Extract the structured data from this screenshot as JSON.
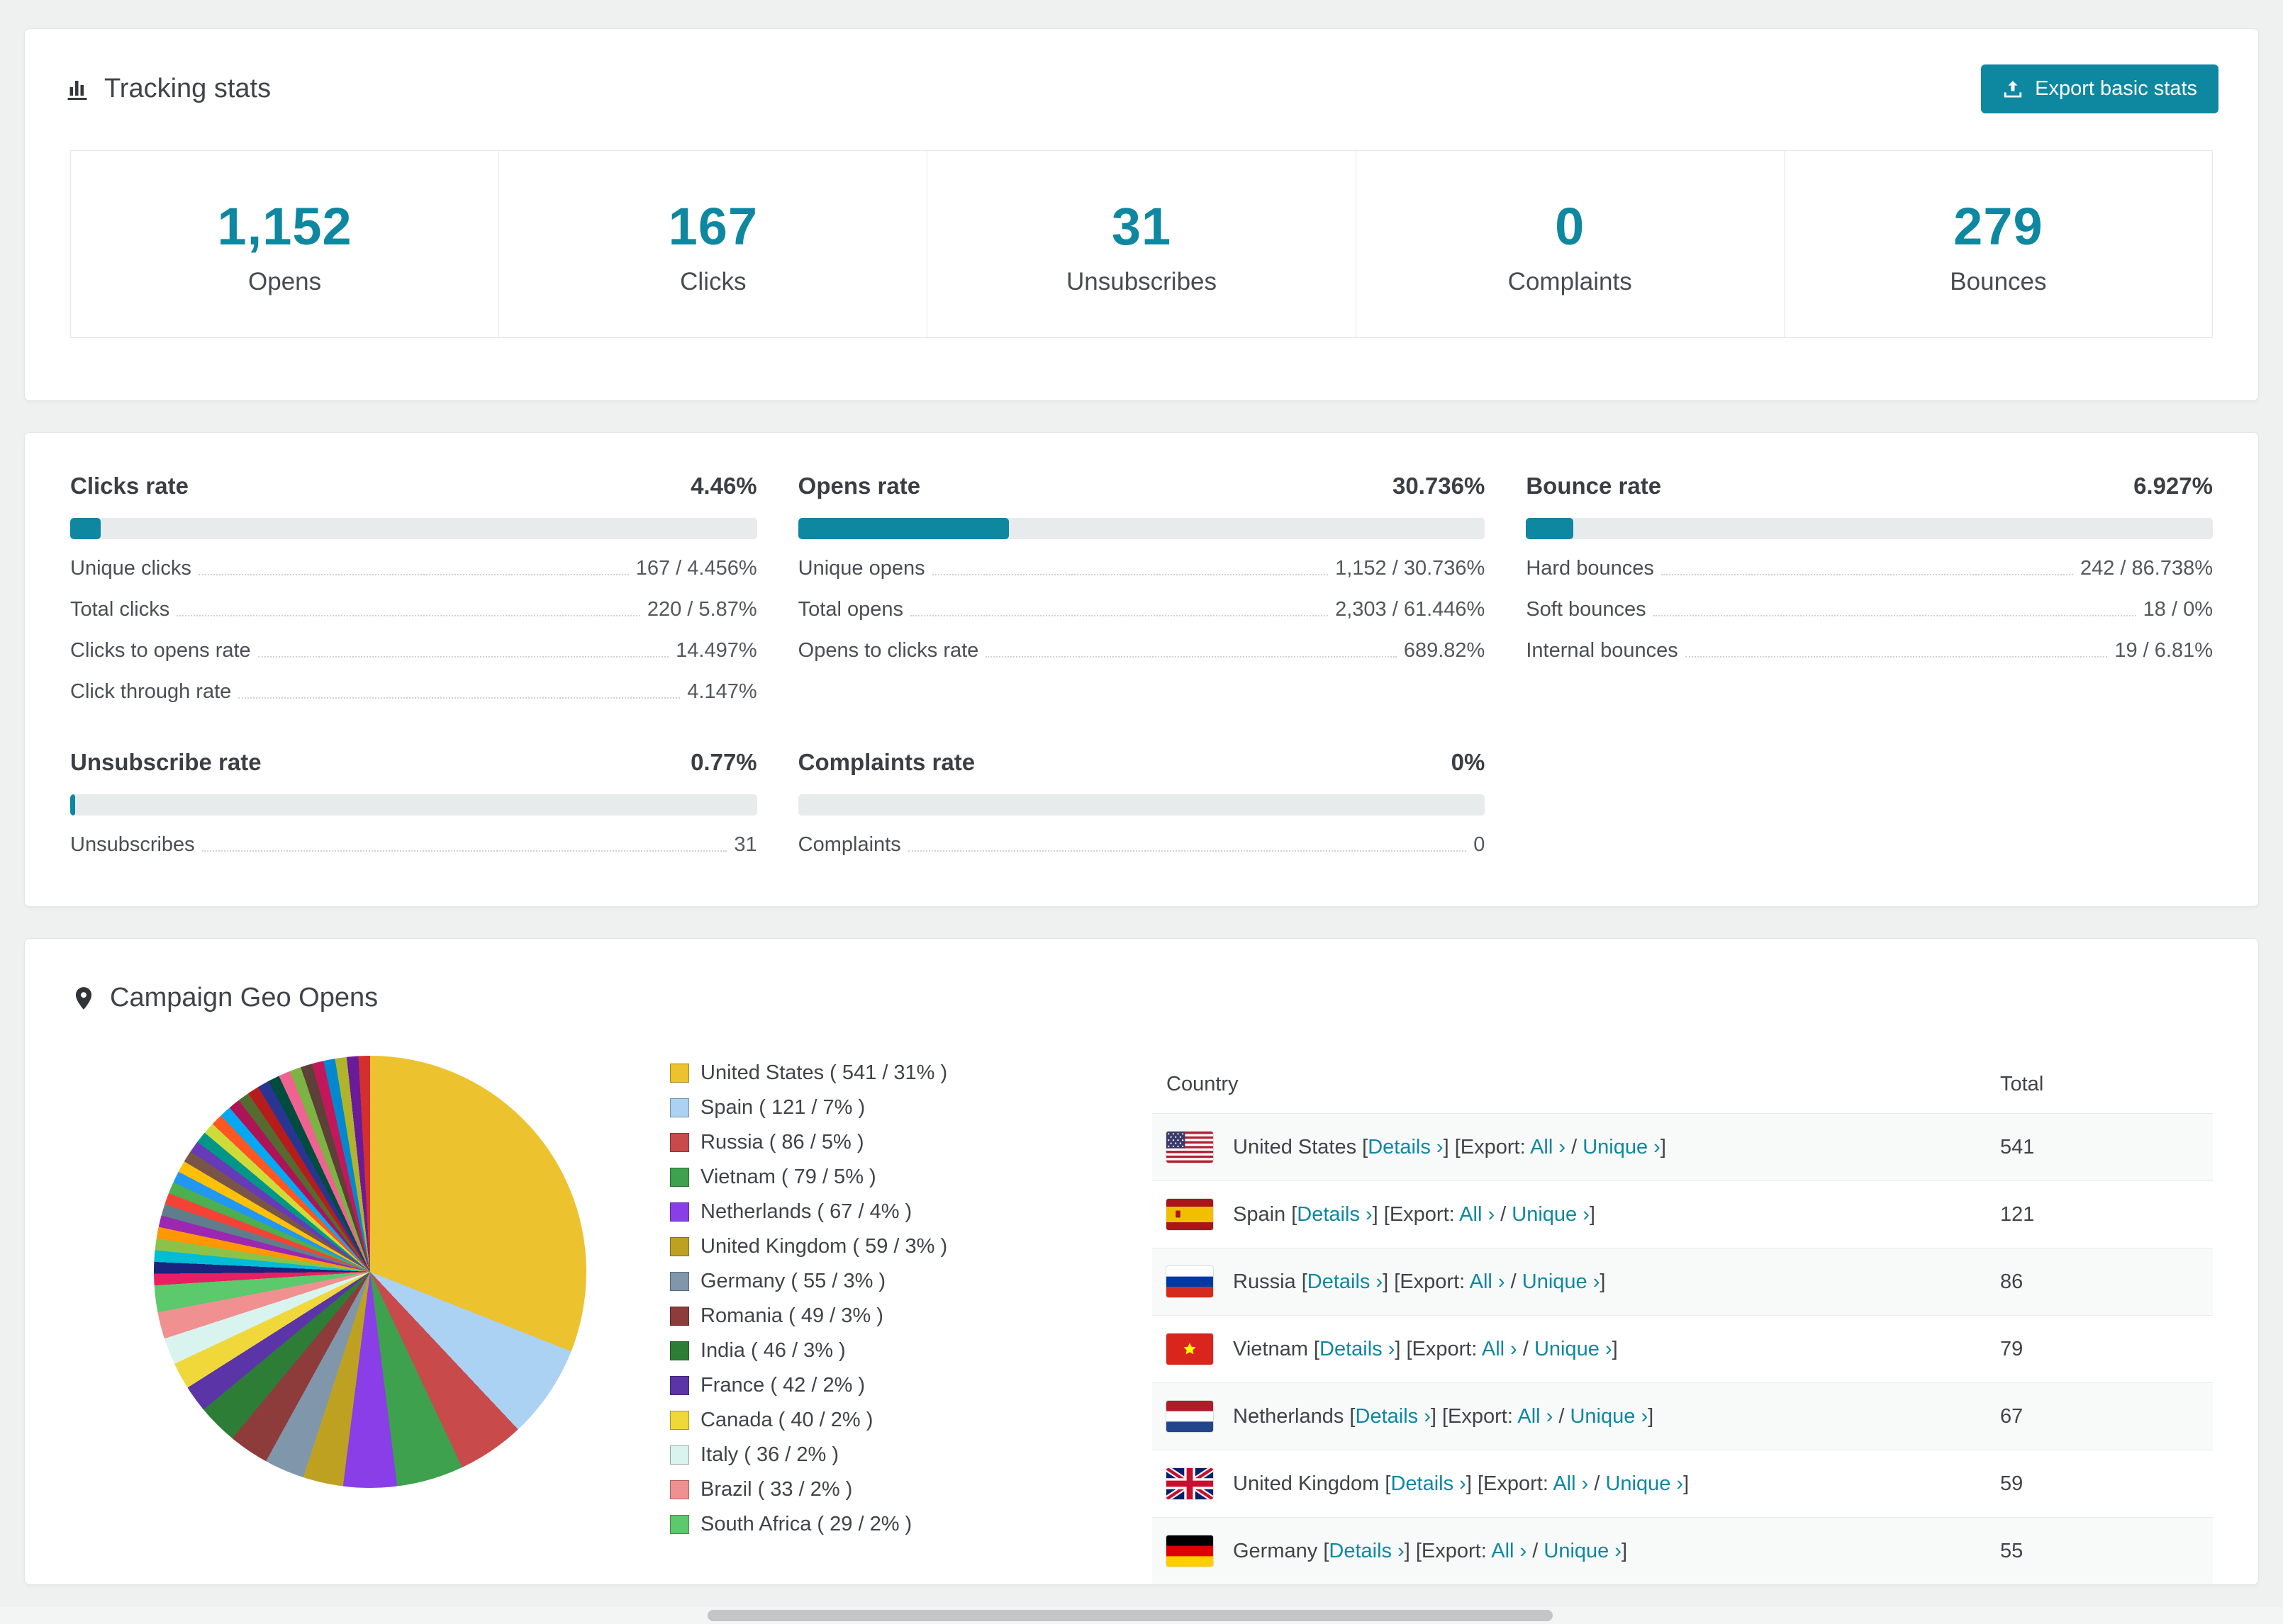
{
  "theme": {
    "accent": "#0e87a1",
    "page_bg": "#eff1f1"
  },
  "tracking": {
    "title": "Tracking stats",
    "export_button": "Export basic stats",
    "stats": [
      {
        "value": "1,152",
        "label": "Opens"
      },
      {
        "value": "167",
        "label": "Clicks"
      },
      {
        "value": "31",
        "label": "Unsubscribes"
      },
      {
        "value": "0",
        "label": "Complaints"
      },
      {
        "value": "279",
        "label": "Bounces"
      }
    ]
  },
  "rates": [
    {
      "title": "Clicks rate",
      "value": "4.46%",
      "percent": 4.46,
      "rows": [
        {
          "label": "Unique clicks",
          "value": "167 / 4.456%"
        },
        {
          "label": "Total clicks",
          "value": "220 / 5.87%"
        },
        {
          "label": "Clicks to opens rate",
          "value": "14.497%"
        },
        {
          "label": "Click through rate",
          "value": "4.147%"
        }
      ]
    },
    {
      "title": "Opens rate",
      "value": "30.736%",
      "percent": 30.736,
      "rows": [
        {
          "label": "Unique opens",
          "value": "1,152 / 30.736%"
        },
        {
          "label": "Total opens",
          "value": "2,303 / 61.446%"
        },
        {
          "label": "Opens to clicks rate",
          "value": "689.82%"
        }
      ]
    },
    {
      "title": "Bounce rate",
      "value": "6.927%",
      "percent": 6.927,
      "rows": [
        {
          "label": "Hard bounces",
          "value": "242 / 86.738%"
        },
        {
          "label": "Soft bounces",
          "value": "18 / 0%"
        },
        {
          "label": "Internal bounces",
          "value": "19 / 6.81%"
        }
      ]
    },
    {
      "title": "Unsubscribe rate",
      "value": "0.77%",
      "percent": 0.77,
      "rows": [
        {
          "label": "Unsubscribes",
          "value": "31"
        }
      ]
    },
    {
      "title": "Complaints rate",
      "value": "0%",
      "percent": 0,
      "rows": [
        {
          "label": "Complaints",
          "value": "0"
        }
      ]
    }
  ],
  "geo": {
    "title": "Campaign Geo Opens",
    "table": {
      "headers": [
        "Country",
        "Total"
      ],
      "links": {
        "details": "Details ›",
        "export_label": "Export:",
        "all": "All ›",
        "unique": "Unique ›",
        "open": "[",
        "close": "]",
        "slash": "/"
      },
      "rows": [
        {
          "country": "United States",
          "flag": "us",
          "total": "541"
        },
        {
          "country": "Spain",
          "flag": "es",
          "total": "121"
        },
        {
          "country": "Russia",
          "flag": "ru",
          "total": "86"
        },
        {
          "country": "Vietnam",
          "flag": "vn",
          "total": "79"
        },
        {
          "country": "Netherlands",
          "flag": "nl",
          "total": "67"
        },
        {
          "country": "United Kingdom",
          "flag": "gb",
          "total": "59"
        },
        {
          "country": "Germany",
          "flag": "de",
          "total": "55"
        }
      ]
    }
  },
  "chart_data": {
    "type": "pie",
    "title": "Campaign Geo Opens",
    "legend_position": "right",
    "slices": [
      {
        "label": "United States",
        "value": 541,
        "percent": 31,
        "color": "#ecc22e",
        "legend": "United States ( 541 / 31% )"
      },
      {
        "label": "Spain",
        "value": 121,
        "percent": 7,
        "color": "#abd1f3",
        "legend": "Spain ( 121 / 7% )"
      },
      {
        "label": "Russia",
        "value": 86,
        "percent": 5,
        "color": "#c94a4a",
        "legend": "Russia ( 86 / 5% )"
      },
      {
        "label": "Vietnam",
        "value": 79,
        "percent": 5,
        "color": "#3da14d",
        "legend": "Vietnam ( 79 / 5% )"
      },
      {
        "label": "Netherlands",
        "value": 67,
        "percent": 4,
        "color": "#8a3ee8",
        "legend": "Netherlands ( 67 / 4% )"
      },
      {
        "label": "United Kingdom",
        "value": 59,
        "percent": 3,
        "color": "#bfa122",
        "legend": "United Kingdom ( 59 / 3% )"
      },
      {
        "label": "Germany",
        "value": 55,
        "percent": 3,
        "color": "#8096ab",
        "legend": "Germany ( 55 / 3% )"
      },
      {
        "label": "Romania",
        "value": 49,
        "percent": 3,
        "color": "#8e3b3b",
        "legend": "Romania ( 49 / 3% )"
      },
      {
        "label": "India",
        "value": 46,
        "percent": 3,
        "color": "#2e7d36",
        "legend": "India ( 46 / 3% )"
      },
      {
        "label": "France",
        "value": 42,
        "percent": 2,
        "color": "#5b35a8",
        "legend": "France ( 42 / 2% )"
      },
      {
        "label": "Canada",
        "value": 40,
        "percent": 2,
        "color": "#f0d83a",
        "legend": "Canada ( 40 / 2% )"
      },
      {
        "label": "Italy",
        "value": 36,
        "percent": 2,
        "color": "#d9f4ef",
        "legend": "Italy ( 36 / 2% )"
      },
      {
        "label": "Brazil",
        "value": 33,
        "percent": 2,
        "color": "#f19090",
        "legend": "Brazil ( 33 / 2% )"
      },
      {
        "label": "South Africa",
        "value": 29,
        "percent": 2,
        "color": "#5bc96c",
        "legend": "South Africa ( 29 / 2% )"
      }
    ],
    "other_colors": [
      "#e91e63",
      "#1a237e",
      "#00bcd4",
      "#8bc34a",
      "#ff9800",
      "#9c27b0",
      "#607d8b",
      "#f44336",
      "#4caf50",
      "#2196f3",
      "#ffc107",
      "#795548",
      "#673ab7",
      "#009688",
      "#cddc39",
      "#ff5722",
      "#03a9f4",
      "#ad1457",
      "#556b2f",
      "#b71c1c",
      "#283593",
      "#004d40",
      "#f06292",
      "#7cb342",
      "#5d4037",
      "#c2185b",
      "#0288d1",
      "#afb42b",
      "#6a1b9a",
      "#d32f2f"
    ]
  }
}
